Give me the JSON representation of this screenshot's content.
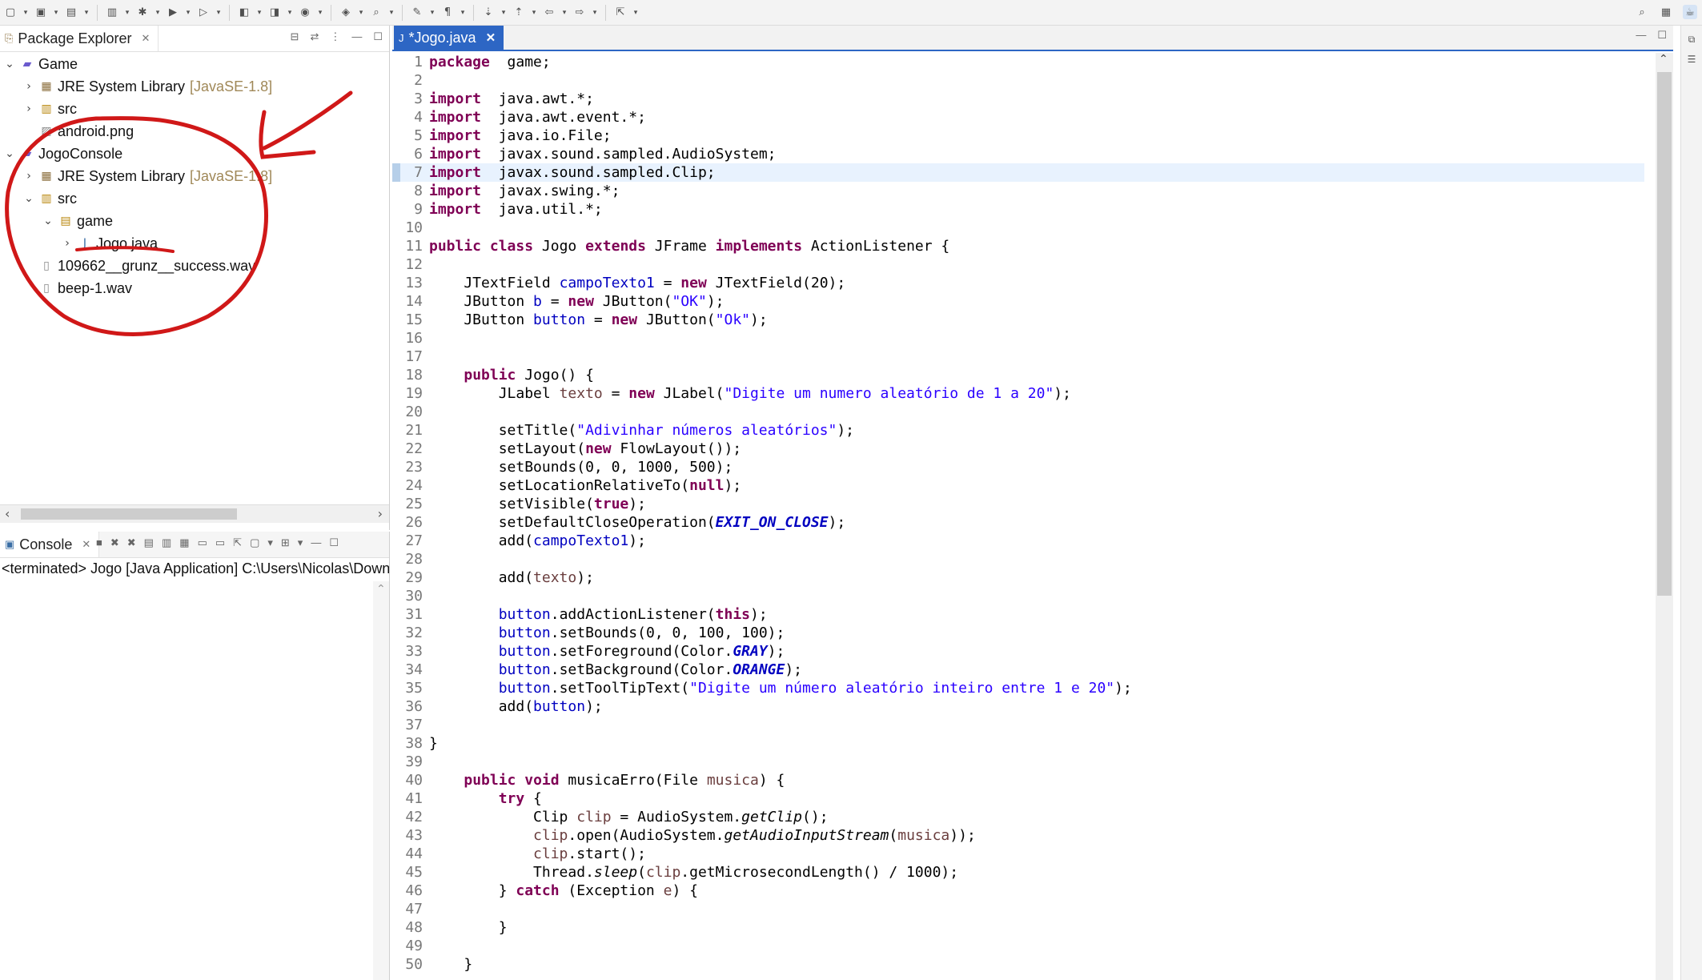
{
  "package_explorer": {
    "tab_label": "Package Explorer",
    "tree": [
      {
        "label": "Game",
        "indent": 0,
        "chev": "⌄",
        "icon": "project-icon"
      },
      {
        "label": "JRE System Library",
        "decor": "[JavaSE-1.8]",
        "indent": 1,
        "chev": "›",
        "icon": "library-icon"
      },
      {
        "label": "src",
        "indent": 1,
        "chev": "›",
        "icon": "source-folder-icon"
      },
      {
        "label": "android.png",
        "indent": 1,
        "chev": "",
        "icon": "image-file-icon"
      },
      {
        "label": "JogoConsole",
        "indent": 0,
        "chev": "⌄",
        "icon": "project-icon"
      },
      {
        "label": "JRE System Library",
        "decor": "[JavaSE-1.8]",
        "indent": 1,
        "chev": "›",
        "icon": "library-icon"
      },
      {
        "label": "src",
        "indent": 1,
        "chev": "⌄",
        "icon": "source-folder-icon"
      },
      {
        "label": "game",
        "indent": 2,
        "chev": "⌄",
        "icon": "package-icon"
      },
      {
        "label": "Jogo.java",
        "indent": 3,
        "chev": "›",
        "icon": "java-file-icon"
      },
      {
        "label": "109662__grunz__success.wav",
        "indent": 1,
        "chev": "",
        "icon": "file-icon"
      },
      {
        "label": "beep-1.wav",
        "indent": 1,
        "chev": "",
        "icon": "file-icon"
      }
    ]
  },
  "console": {
    "tab_label": "Console",
    "description": "<terminated> Jogo [Java Application] C:\\Users\\Nicolas\\Down"
  },
  "editor": {
    "tab_label": "*Jogo.java",
    "current_line": 7,
    "lines": [
      [
        [
          "kw",
          "package"
        ],
        [
          "",
          "  game;"
        ]
      ],
      [],
      [
        [
          "kw",
          "import"
        ],
        [
          "",
          "  java.awt.*;"
        ]
      ],
      [
        [
          "kw",
          "import"
        ],
        [
          "",
          "  java.awt.event.*;"
        ]
      ],
      [
        [
          "kw",
          "import"
        ],
        [
          "",
          "  java.io.File;"
        ]
      ],
      [
        [
          "kw",
          "import"
        ],
        [
          "",
          "  javax.sound.sampled.AudioSystem;"
        ]
      ],
      [
        [
          "kw",
          "import"
        ],
        [
          "",
          "  javax.sound.sampled.Clip;"
        ]
      ],
      [
        [
          "kw",
          "import"
        ],
        [
          "",
          "  javax.swing.*;"
        ]
      ],
      [
        [
          "kw",
          "import"
        ],
        [
          "",
          "  java.util.*;"
        ]
      ],
      [],
      [
        [
          "kw",
          "public"
        ],
        [
          "",
          " "
        ],
        [
          "kw",
          "class"
        ],
        [
          "",
          " Jogo "
        ],
        [
          "kw",
          "extends"
        ],
        [
          "",
          " JFrame "
        ],
        [
          "kw",
          "implements"
        ],
        [
          "",
          " ActionListener {"
        ]
      ],
      [],
      [
        [
          "",
          "    JTextField "
        ],
        [
          "fld",
          "campoTexto1"
        ],
        [
          "",
          " = "
        ],
        [
          "kw",
          "new"
        ],
        [
          "",
          " JTextField(20);"
        ]
      ],
      [
        [
          "",
          "    JButton "
        ],
        [
          "fld",
          "b"
        ],
        [
          "",
          " = "
        ],
        [
          "kw",
          "new"
        ],
        [
          "",
          " JButton("
        ],
        [
          "str",
          "\"OK\""
        ],
        [
          "",
          ");"
        ]
      ],
      [
        [
          "",
          "    JButton "
        ],
        [
          "fld",
          "button"
        ],
        [
          "",
          " = "
        ],
        [
          "kw",
          "new"
        ],
        [
          "",
          " JButton("
        ],
        [
          "str",
          "\"Ok\""
        ],
        [
          "",
          ");"
        ]
      ],
      [],
      [],
      [
        [
          "",
          "    "
        ],
        [
          "kw",
          "public"
        ],
        [
          "",
          " Jogo() {"
        ]
      ],
      [
        [
          "",
          "        JLabel "
        ],
        [
          "loc",
          "texto"
        ],
        [
          "",
          " = "
        ],
        [
          "kw",
          "new"
        ],
        [
          "",
          " JLabel("
        ],
        [
          "str",
          "\"Digite um numero aleatório de 1 a 20\""
        ],
        [
          "",
          ");"
        ]
      ],
      [],
      [
        [
          "",
          "        setTitle("
        ],
        [
          "str",
          "\"Adivinhar números aleatórios\""
        ],
        [
          "",
          ");"
        ]
      ],
      [
        [
          "",
          "        setLayout("
        ],
        [
          "kw",
          "new"
        ],
        [
          "",
          " FlowLayout());"
        ]
      ],
      [
        [
          "",
          "        setBounds(0, 0, 1000, 500);"
        ]
      ],
      [
        [
          "",
          "        setLocationRelativeTo("
        ],
        [
          "kw",
          "null"
        ],
        [
          "",
          ");"
        ]
      ],
      [
        [
          "",
          "        setVisible("
        ],
        [
          "kw",
          "true"
        ],
        [
          "",
          ");"
        ]
      ],
      [
        [
          "",
          "        setDefaultCloseOperation("
        ],
        [
          "sfld",
          "EXIT_ON_CLOSE"
        ],
        [
          "",
          ");"
        ]
      ],
      [
        [
          "",
          "        add("
        ],
        [
          "fld",
          "campoTexto1"
        ],
        [
          "",
          ");"
        ]
      ],
      [],
      [
        [
          "",
          "        add("
        ],
        [
          "loc",
          "texto"
        ],
        [
          "",
          ");"
        ]
      ],
      [],
      [
        [
          "",
          "        "
        ],
        [
          "fld",
          "button"
        ],
        [
          "",
          ".addActionListener("
        ],
        [
          "kw",
          "this"
        ],
        [
          "",
          ");"
        ]
      ],
      [
        [
          "",
          "        "
        ],
        [
          "fld",
          "button"
        ],
        [
          "",
          ".setBounds(0, 0, 100, 100);"
        ]
      ],
      [
        [
          "",
          "        "
        ],
        [
          "fld",
          "button"
        ],
        [
          "",
          ".setForeground(Color."
        ],
        [
          "sfld",
          "GRAY"
        ],
        [
          "",
          ");"
        ]
      ],
      [
        [
          "",
          "        "
        ],
        [
          "fld",
          "button"
        ],
        [
          "",
          ".setBackground(Color."
        ],
        [
          "sfld",
          "ORANGE"
        ],
        [
          "",
          ");"
        ]
      ],
      [
        [
          "",
          "        "
        ],
        [
          "fld",
          "button"
        ],
        [
          "",
          ".setToolTipText("
        ],
        [
          "str",
          "\"Digite um número aleatório inteiro entre 1 e 20\""
        ],
        [
          "",
          ");"
        ]
      ],
      [
        [
          "",
          "        add("
        ],
        [
          "fld",
          "button"
        ],
        [
          "",
          ");"
        ]
      ],
      [],
      [
        [
          "",
          "}"
        ]
      ],
      [],
      [
        [
          "",
          "    "
        ],
        [
          "kw",
          "public"
        ],
        [
          "",
          " "
        ],
        [
          "kw",
          "void"
        ],
        [
          "",
          " musicaErro(File "
        ],
        [
          "loc",
          "musica"
        ],
        [
          "",
          ") {"
        ]
      ],
      [
        [
          "",
          "        "
        ],
        [
          "kw",
          "try"
        ],
        [
          "",
          " {"
        ]
      ],
      [
        [
          "",
          "            Clip "
        ],
        [
          "loc",
          "clip"
        ],
        [
          "",
          " = AudioSystem."
        ],
        [
          "smeth",
          "getClip"
        ],
        [
          "",
          "();"
        ]
      ],
      [
        [
          "",
          "            "
        ],
        [
          "loc",
          "clip"
        ],
        [
          "",
          ".open(AudioSystem."
        ],
        [
          "smeth",
          "getAudioInputStream"
        ],
        [
          "",
          "("
        ],
        [
          "loc",
          "musica"
        ],
        [
          "",
          "));"
        ]
      ],
      [
        [
          "",
          "            "
        ],
        [
          "loc",
          "clip"
        ],
        [
          "",
          ".start();"
        ]
      ],
      [
        [
          "",
          "            Thread."
        ],
        [
          "smeth",
          "sleep"
        ],
        [
          "",
          "("
        ],
        [
          "loc",
          "clip"
        ],
        [
          "",
          ".getMicrosecondLength() / 1000);"
        ]
      ],
      [
        [
          "",
          "        } "
        ],
        [
          "kw",
          "catch"
        ],
        [
          "",
          " (Exception "
        ],
        [
          "loc",
          "e"
        ],
        [
          "",
          ") {"
        ]
      ],
      [],
      [
        [
          "",
          "        }"
        ]
      ],
      [],
      [
        [
          "",
          "    }"
        ]
      ]
    ]
  },
  "toolbar": {
    "icons": [
      "new-icon",
      "save-icon",
      "save-all-icon",
      "sep",
      "print-icon",
      "debug-icon",
      "run-icon",
      "run-external-icon",
      "sep",
      "new-java-project-icon",
      "new-package-icon",
      "new-class-icon",
      "sep",
      "open-type-icon",
      "search-icon",
      "sep",
      "toggle-mark-icon",
      "show-whitespace-icon",
      "sep",
      "next-annotation-icon",
      "prev-annotation-icon",
      "back-icon",
      "forward-icon",
      "sep",
      "pin-editor-icon"
    ]
  },
  "colors": {
    "editor_tab_active": "#2d66c4",
    "annotation_red": "#d01818"
  }
}
